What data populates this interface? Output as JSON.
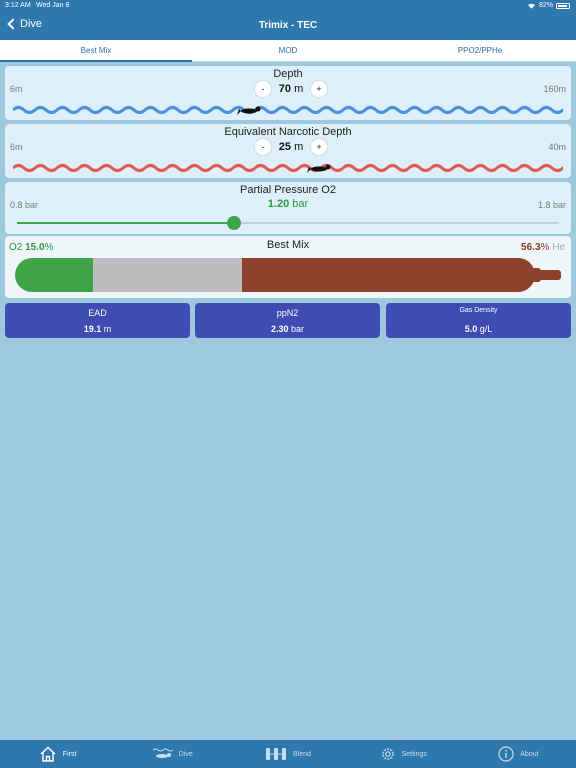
{
  "status_bar": {
    "time": "3:12 AM",
    "date": "Wed Jan 8",
    "battery": "82%"
  },
  "nav": {
    "back_label": "Dive",
    "title": "Trimix - TEC"
  },
  "tabs": [
    {
      "label": "Best Mix",
      "active": true
    },
    {
      "label": "MOD",
      "active": false
    },
    {
      "label": "PPO2/PPHe",
      "active": false
    }
  ],
  "depth": {
    "title": "Depth",
    "min": "6m",
    "max": "160m",
    "value": "70",
    "unit": "m",
    "minus": "-",
    "plus": "+",
    "wave_color": "#4a92d8"
  },
  "end": {
    "title": "Equivalent Narcotic Depth",
    "min": "6m",
    "max": "40m",
    "value": "25",
    "unit": "m",
    "minus": "-",
    "plus": "+",
    "wave_color": "#e05a5a"
  },
  "ppo2": {
    "title": "Partial Pressure O2",
    "min": "0.8 bar",
    "max": "1.8 bar",
    "value": "1.20",
    "unit": "bar",
    "fraction": 0.4
  },
  "best_mix": {
    "title": "Best Mix",
    "o2_name": "O2",
    "o2_value": "15.0",
    "o2_unit": "%",
    "he_value": "56.3",
    "he_unit": "%",
    "he_name": "He",
    "o2_percent": 15.0,
    "n2_percent": 28.7,
    "he_percent": 56.3,
    "colors": {
      "o2": "#3fa548",
      "n2": "#bdbdc0",
      "he": "#8b412b"
    }
  },
  "cards": [
    {
      "label": "EAD",
      "value": "19.1",
      "unit": "m"
    },
    {
      "label": "ppN2",
      "value": "2.30",
      "unit": "bar"
    },
    {
      "label": "Gas Density",
      "value": "5.0",
      "unit": "g/L"
    }
  ],
  "bottom_nav": [
    {
      "label": "First",
      "icon": "home-icon",
      "active": true
    },
    {
      "label": "Dive",
      "icon": "diver-icon",
      "active": false
    },
    {
      "label": "Blend",
      "icon": "blend-icon",
      "active": false
    },
    {
      "label": "Settings",
      "icon": "gear-icon",
      "active": false
    },
    {
      "label": "About",
      "icon": "info-icon",
      "active": false
    }
  ],
  "colors": {
    "accent": "#2f78ad",
    "card": "#3f4cb2",
    "background": "#9ec8de"
  }
}
